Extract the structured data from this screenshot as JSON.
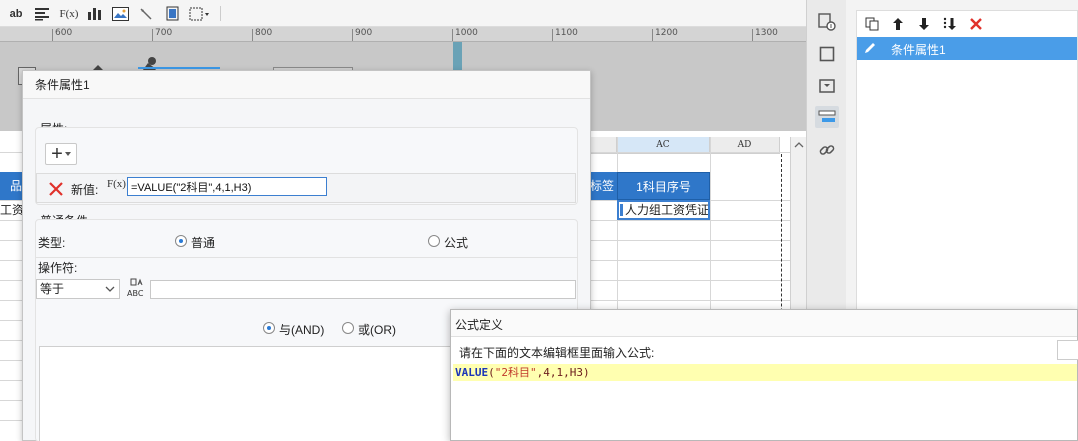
{
  "toolbar": {
    "items": [
      "ab",
      "F(x)"
    ]
  },
  "ruler": {
    "labels": [
      "600",
      "700",
      "800",
      "900",
      "1000",
      "1100",
      "1200",
      "1300"
    ]
  },
  "sheet": {
    "columns": [
      "AC",
      "AD"
    ],
    "left_header_fragment": "品",
    "left_cell_fragment": "工资",
    "tag_header_fragment": "标签",
    "seq_header": "1科目序号",
    "seq_cell": "人力组工资凭证"
  },
  "right_panel": {
    "list_items": [
      {
        "label": "条件属性1",
        "selected": true
      }
    ]
  },
  "condition_dialog": {
    "title": "条件属性1",
    "properties_label": "属性:",
    "add_button": "+",
    "new_value_label": "新值:",
    "formula_glyph": "F(x)",
    "new_value": "=VALUE(\"2科目\",4,1,H3)",
    "common_condition_label": "普通条件",
    "type_label": "类型:",
    "type_options": [
      "普通",
      "公式"
    ],
    "type_selected": "普通",
    "operator_label": "操作符:",
    "operator_value": "等于",
    "abc_glyph": "ABC",
    "logic_options": [
      "与(AND)",
      "或(OR)"
    ],
    "logic_selected": "与(AND)"
  },
  "formula_dialog": {
    "title": "公式定义",
    "prompt": "请在下面的文本编辑框里面输入公式:",
    "code_func": "VALUE",
    "code_open": "(",
    "code_string": "\"2科目\"",
    "code_rest": ",4,1,H3)"
  },
  "colors": {
    "accent": "#3c99e8",
    "header_blue": "#2f77c9",
    "selection_blue": "#4a9de8",
    "formula_highlight": "#ffffb0",
    "delete_red": "#e0312b"
  }
}
